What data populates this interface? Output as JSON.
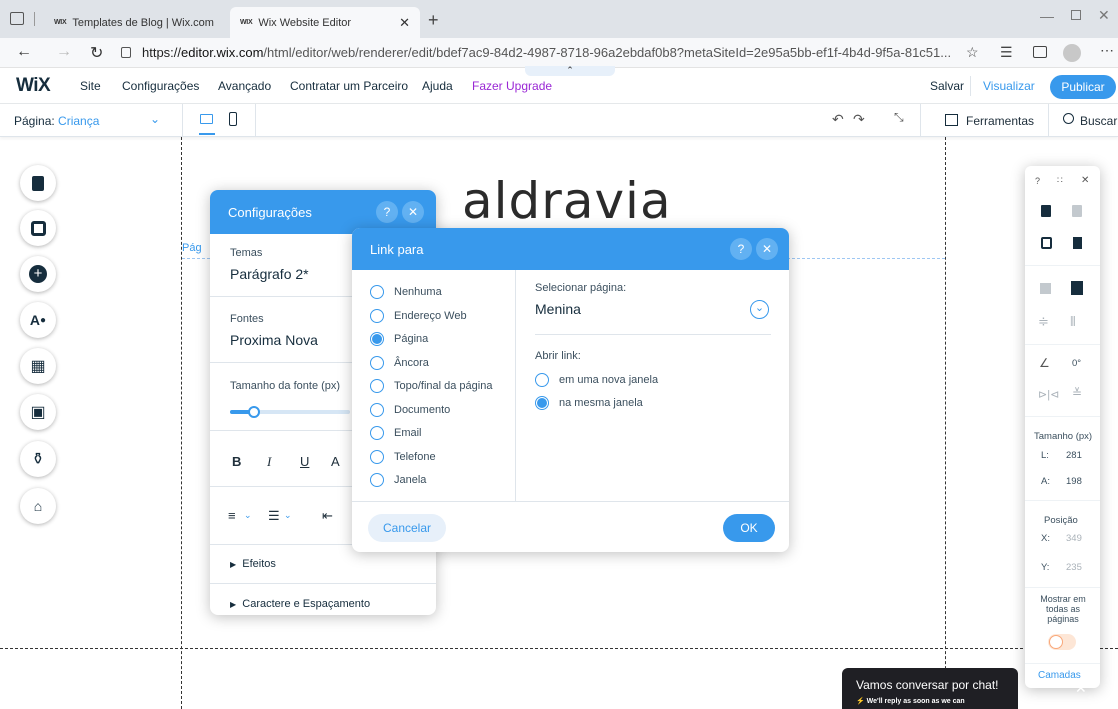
{
  "browser": {
    "tabs": [
      {
        "label": "Templates de Blog | Wix.com"
      },
      {
        "label": "Wix Website Editor"
      }
    ],
    "url_prefix": "https://",
    "url_host": "editor.wix.com",
    "url_path": "/html/editor/web/renderer/edit/bdef7ac9-84d2-4987-8718-96a2ebdaf0b8?metaSiteId=2e95a5bb-ef1f-4b4d-9f5a-81c51..."
  },
  "wixbar": {
    "logo": "WiX",
    "menu": [
      "Site",
      "Configurações",
      "Avançado",
      "Contratar um Parceiro",
      "Ajuda",
      "Fazer Upgrade"
    ],
    "save": "Salvar",
    "preview": "Visualizar",
    "publish": "Publicar"
  },
  "toolbar": {
    "page_label": "Página:",
    "page_value": "Criança",
    "tools": "Ferramentas",
    "search": "Buscar"
  },
  "stage": {
    "title": "aldravia",
    "partial_label": "Pág"
  },
  "settings_panel": {
    "title": "Configurações",
    "theme_label": "Temas",
    "theme_value": "Parágrafo 2*",
    "font_label": "Fontes",
    "font_value": "Proxima Nova",
    "size_label": "Tamanho da fonte (px)",
    "effects": "Efeitos",
    "char_spacing": "Caractere e Espaçamento"
  },
  "link_dialog": {
    "title": "Link para",
    "options": [
      {
        "label": "Nenhuma",
        "selected": false
      },
      {
        "label": "Endereço Web",
        "selected": false
      },
      {
        "label": "Página",
        "selected": true
      },
      {
        "label": "Âncora",
        "selected": false
      },
      {
        "label": "Topo/final da página",
        "selected": false
      },
      {
        "label": "Documento",
        "selected": false
      },
      {
        "label": "Email",
        "selected": false
      },
      {
        "label": "Telefone",
        "selected": false
      },
      {
        "label": "Janela",
        "selected": false
      }
    ],
    "select_page_label": "Selecionar página:",
    "select_page_value": "Menina",
    "open_link_label": "Abrir link:",
    "open_options": [
      {
        "label": "em uma nova janela",
        "selected": false
      },
      {
        "label": "na mesma janela",
        "selected": true
      }
    ],
    "cancel": "Cancelar",
    "ok": "OK"
  },
  "right_panel": {
    "size_title": "Tamanho (px)",
    "w_label": "L:",
    "w_value": "281",
    "h_label": "A:",
    "h_value": "198",
    "angle_value": "0°",
    "pos_title": "Posição",
    "x_label": "X:",
    "x_value": "349",
    "y_label": "Y:",
    "y_value": "235",
    "show_all": "Mostrar em todas as páginas",
    "layers": "Camadas"
  },
  "chat": {
    "title": "Vamos conversar por chat!",
    "sub": "We'll reply as soon as we can"
  },
  "colors": {
    "accent": "#3899ec",
    "upgrade": "#9a27d5",
    "dark": "#20303c"
  }
}
